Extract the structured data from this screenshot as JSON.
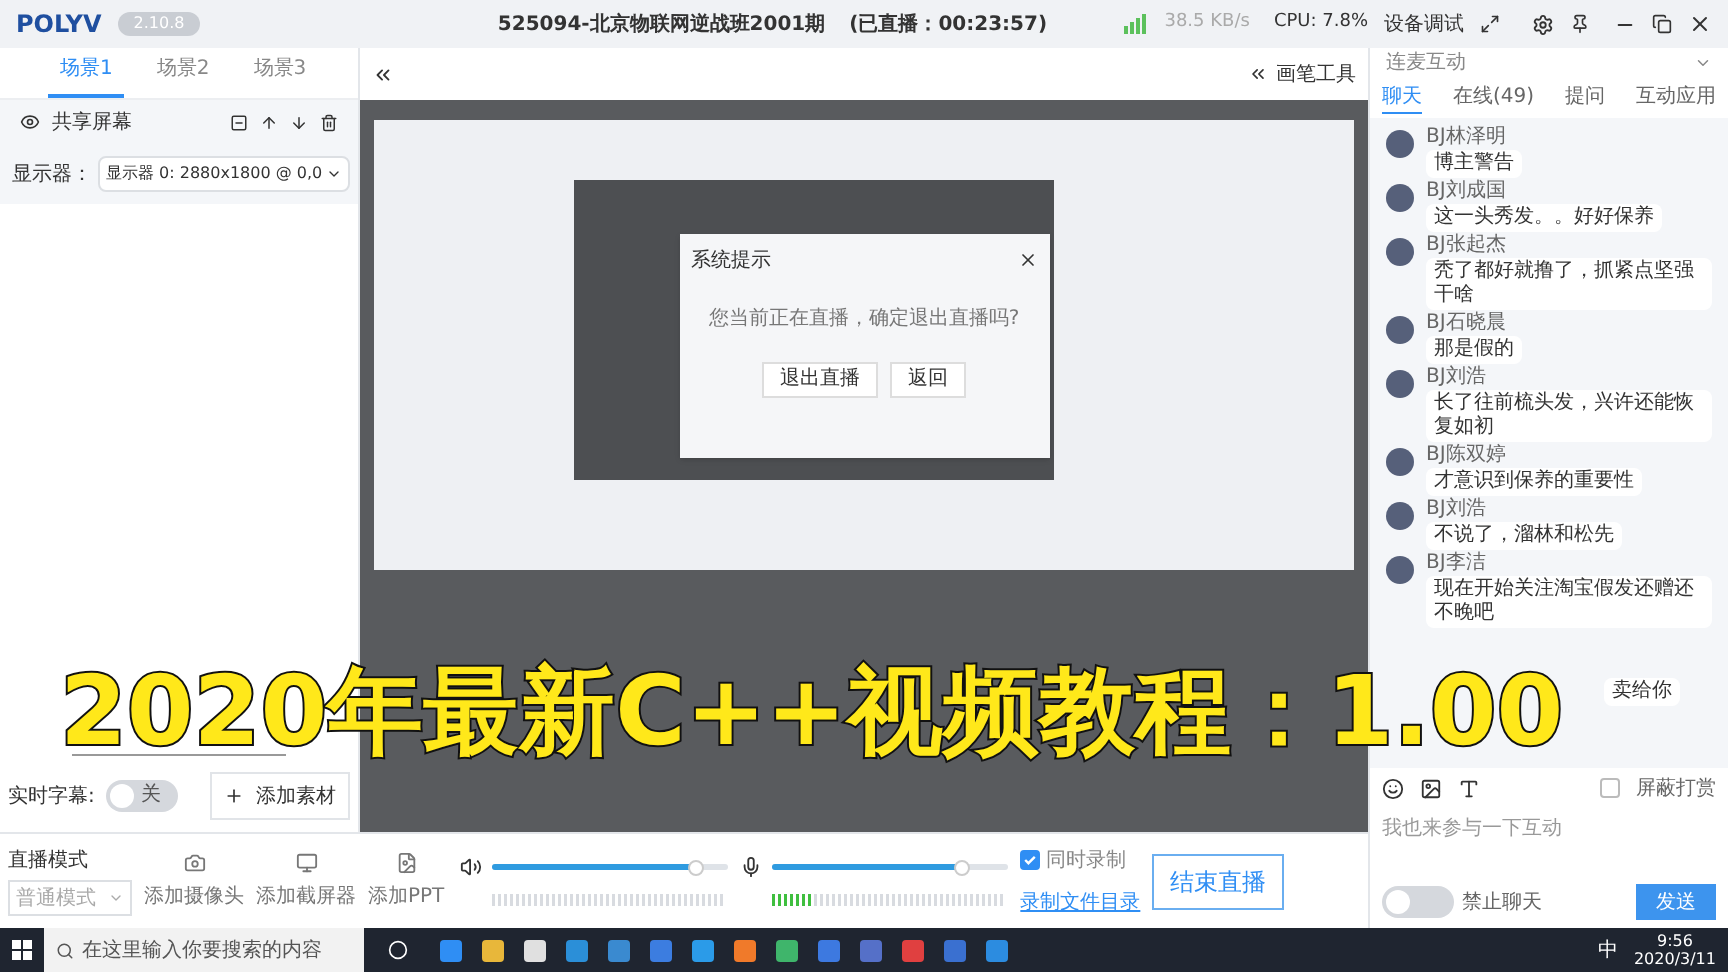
{
  "app": {
    "logo": "POLYV",
    "version": "2.10.8",
    "title": "525094-北京物联网逆战班2001期",
    "live_time": "(已直播：00:23:57)",
    "net_speed": "38.5 KB/s",
    "cpu": "CPU: 7.8%",
    "device_test": "设备调试"
  },
  "scene_tabs": [
    {
      "label": "场景1",
      "selected": true
    },
    {
      "label": "场景2",
      "selected": false
    },
    {
      "label": "场景3",
      "selected": false
    }
  ],
  "source": {
    "name": "共享屏幕",
    "display_label": "显示器：",
    "display_value": "显示器 0: 2880x1800 @ 0,0"
  },
  "subtitle": {
    "label": "实时字幕:",
    "on": false,
    "toggle_text": "关"
  },
  "add_material": "添加素材",
  "stage": {
    "pen_tools": "画笔工具",
    "dialog": {
      "title": "系统提示",
      "message": "您当前正在直播，确定退出直播吗?",
      "buttons": [
        "退出直播",
        "返回"
      ]
    }
  },
  "caption": "2020年最新C++视频教程：1.00",
  "bottom": {
    "mode_label": "直播模式",
    "mode_value": "普通模式",
    "sources": [
      {
        "kind": "camera",
        "label": "添加摄像头"
      },
      {
        "kind": "screen",
        "label": "添加截屏器"
      },
      {
        "kind": "ppt",
        "label": "添加PPT"
      }
    ],
    "speaker": {
      "level": 0.86
    },
    "mic": {
      "level": 0.8
    },
    "record": {
      "label": "同时录制",
      "checked": true
    },
    "record_dir": "录制文件目录",
    "end_button": "结束直播"
  },
  "chat": {
    "mode": "连麦互动",
    "tabs": [
      {
        "label": "聊天",
        "selected": true
      },
      {
        "label": "在线(49)",
        "selected": false
      },
      {
        "label": "提问",
        "selected": false
      },
      {
        "label": "互动应用",
        "selected": false
      }
    ],
    "messages": [
      {
        "kind": "full",
        "name": "BJ林泽明",
        "text": "博主警告"
      },
      {
        "kind": "full",
        "name": "BJ刘成国",
        "text": "这一头秀发。。好好保养"
      },
      {
        "kind": "full",
        "name": "BJ张起杰",
        "text": "秃了都好就撸了，抓紧点坚强干啥"
      },
      {
        "kind": "full",
        "name": "BJ石晓晨",
        "text": "那是假的"
      },
      {
        "kind": "full",
        "name": "BJ刘浩",
        "text": "长了往前梳头发，兴许还能恢复如初"
      },
      {
        "kind": "full",
        "name": "BJ陈双婷",
        "text": "才意识到保养的重要性"
      },
      {
        "kind": "full",
        "name": "BJ刘浩",
        "text": "不说了，溜林和松先"
      },
      {
        "kind": "full",
        "name": "BJ李洁",
        "text": "现在开始关注淘宝假发还赠还不晚吧"
      },
      {
        "kind": "partial",
        "text": "卖给你"
      }
    ],
    "block_reward": {
      "label": "屏蔽打赏",
      "checked": false
    },
    "placeholder": "我也来参与一下互动",
    "mute": {
      "label": "禁止聊天",
      "on": false
    },
    "send": "发送"
  },
  "taskbar": {
    "search_placeholder": "在这里输入你要搜索的内容",
    "ime": "中",
    "time": "9:56",
    "date": "2020/3/11"
  }
}
